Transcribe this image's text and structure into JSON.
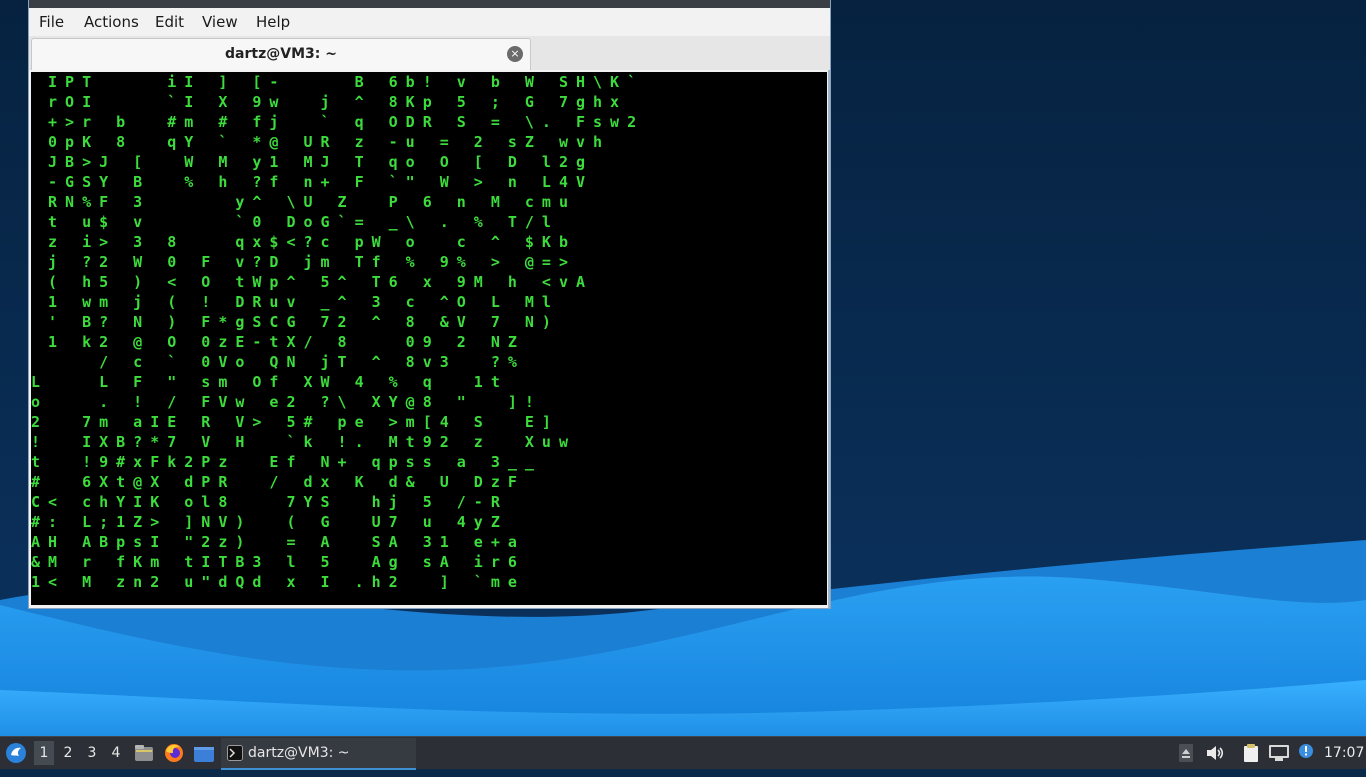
{
  "window": {
    "menu": [
      "File",
      "Actions",
      "Edit",
      "View",
      "Help"
    ],
    "tab_title": "dartz@VM3: ~",
    "tab_close": "×"
  },
  "terminal": {
    "lines": [
      " IPT    iI ] [-    B 6b! v b W SH\\K`",
      " rOI    `I X 9w  j ^ 8Kp 5 ; G 7ghx",
      " +>r b  #m # fj  ` q ODR S = \\. Fsw2",
      " 0pK 8  qY ` *@ UR z -u = 2 sZ wvh",
      " JB>J [  W M y1 MJ T qo O [ D l2g",
      " -GSY B  % h ?f n+ F `\" W > n L4V",
      " RN%F 3     y^ \\U Z  P 6 n M cmu",
      " t u$ v     `0 DoG`= _\\ . % T/l",
      " z i> 3 8   qx$<?c pW o  c ^ $Kb",
      " j ?2 W 0 F v?D jm Tf % 9% > @=>",
      " ( h5 ) < O tWp^ 5^ T6 x 9M h <vA",
      " 1 wm j ( ! DRuv _^ 3 c ^O L Ml",
      " ' B? N ) F*gSCG 72 ^ 8 &V 7 N)",
      " 1 k2 @ O 0zE-tX/ 8   09 2 NZ",
      "    / c ` 0Vo QN jT ^ 8v3  ?%",
      "L   L F \" sm Of XW 4 % q  1t",
      "o   . ! / FVw e2 ?\\ XY@8 \"  ]!",
      "2  7m aIE R V> 5# pe >m[4 S  E]",
      "!  IXB?*7 V H  `k !. Mt92 z  Xuw",
      "t  !9#xFk2Pz  Ef N+ qpss a 3__",
      "#  6Xt@X dPR  / dx K d& U DzF",
      "C< chYIK ol8   7YS  hj 5 /-R",
      "#: L;1Z> ]NV)  ( G  U7 u 4yZ",
      "AH ABpsI \"2z)  = A  SA 31 e+a",
      "&M r fKm tITB3 l 5  Ag sA ir6",
      "1< M zn2 u\"dQd x I .h2  ] `me"
    ]
  },
  "taskbar": {
    "workspaces": [
      "1",
      "2",
      "3",
      "4"
    ],
    "task_label": "dartz@VM3: ~",
    "clock": "17:07"
  },
  "colors": {
    "matrix_green": "#3ddc3d",
    "desktop_dark": "#0b2a4a",
    "wave_blue": "#1e8fe8",
    "taskbar": "#2c3036"
  }
}
